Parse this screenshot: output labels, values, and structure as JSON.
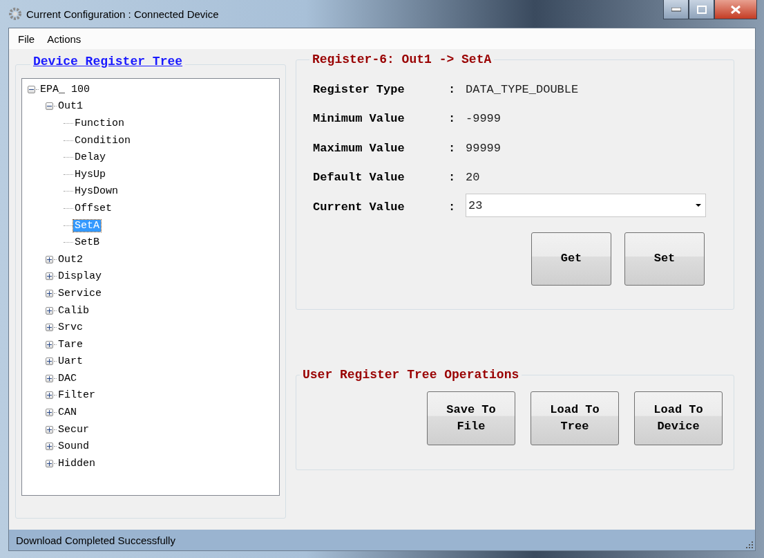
{
  "window": {
    "title": "Current Configuration : Connected Device"
  },
  "menu": [
    "File",
    "Actions"
  ],
  "tree_panel": {
    "title": "Device Register Tree",
    "tree": [
      {
        "label": "EPA_ 100",
        "expanded": true,
        "selected": false,
        "children": [
          {
            "label": "Out1",
            "expanded": true,
            "selected": false,
            "children": [
              {
                "label": "Function",
                "selected": false
              },
              {
                "label": "Condition",
                "selected": false
              },
              {
                "label": "Delay",
                "selected": false
              },
              {
                "label": "HysUp",
                "selected": false
              },
              {
                "label": "HysDown",
                "selected": false
              },
              {
                "label": "Offset",
                "selected": false
              },
              {
                "label": "SetA",
                "selected": true
              },
              {
                "label": "SetB",
                "selected": false
              }
            ]
          },
          {
            "label": "Out2",
            "expanded": false,
            "selected": false
          },
          {
            "label": "Display",
            "expanded": false,
            "selected": false
          },
          {
            "label": "Service",
            "expanded": false,
            "selected": false
          },
          {
            "label": "Calib",
            "expanded": false,
            "selected": false
          },
          {
            "label": "Srvc",
            "expanded": false,
            "selected": false
          },
          {
            "label": "Tare",
            "expanded": false,
            "selected": false
          },
          {
            "label": "Uart",
            "expanded": false,
            "selected": false
          },
          {
            "label": "DAC",
            "expanded": false,
            "selected": false
          },
          {
            "label": "Filter",
            "expanded": false,
            "selected": false
          },
          {
            "label": "CAN",
            "expanded": false,
            "selected": false
          },
          {
            "label": "Secur",
            "expanded": false,
            "selected": false
          },
          {
            "label": "Sound",
            "expanded": false,
            "selected": false
          },
          {
            "label": "Hidden",
            "expanded": false,
            "selected": false
          }
        ]
      }
    ]
  },
  "register_panel": {
    "title": "Register-6: Out1 -> SetA",
    "fields": [
      {
        "label": "Register Type",
        "separator": ":",
        "value": "DATA_TYPE_DOUBLE"
      },
      {
        "label": "Minimum Value",
        "separator": ":",
        "value": "-9999"
      },
      {
        "label": "Maximum Value",
        "separator": ":",
        "value": "99999"
      },
      {
        "label": "Default Value",
        "separator": ":",
        "value": "20"
      }
    ],
    "current": {
      "label": "Current Value",
      "separator": ":",
      "value": "23"
    },
    "buttons": [
      "Get",
      "Set"
    ]
  },
  "operations_panel": {
    "title": "User Register Tree Operations",
    "buttons": [
      "Save To\nFile",
      "Load To\nTree",
      "Load To\nDevice"
    ]
  },
  "status_bar": {
    "text": "Download Completed Successfully"
  }
}
